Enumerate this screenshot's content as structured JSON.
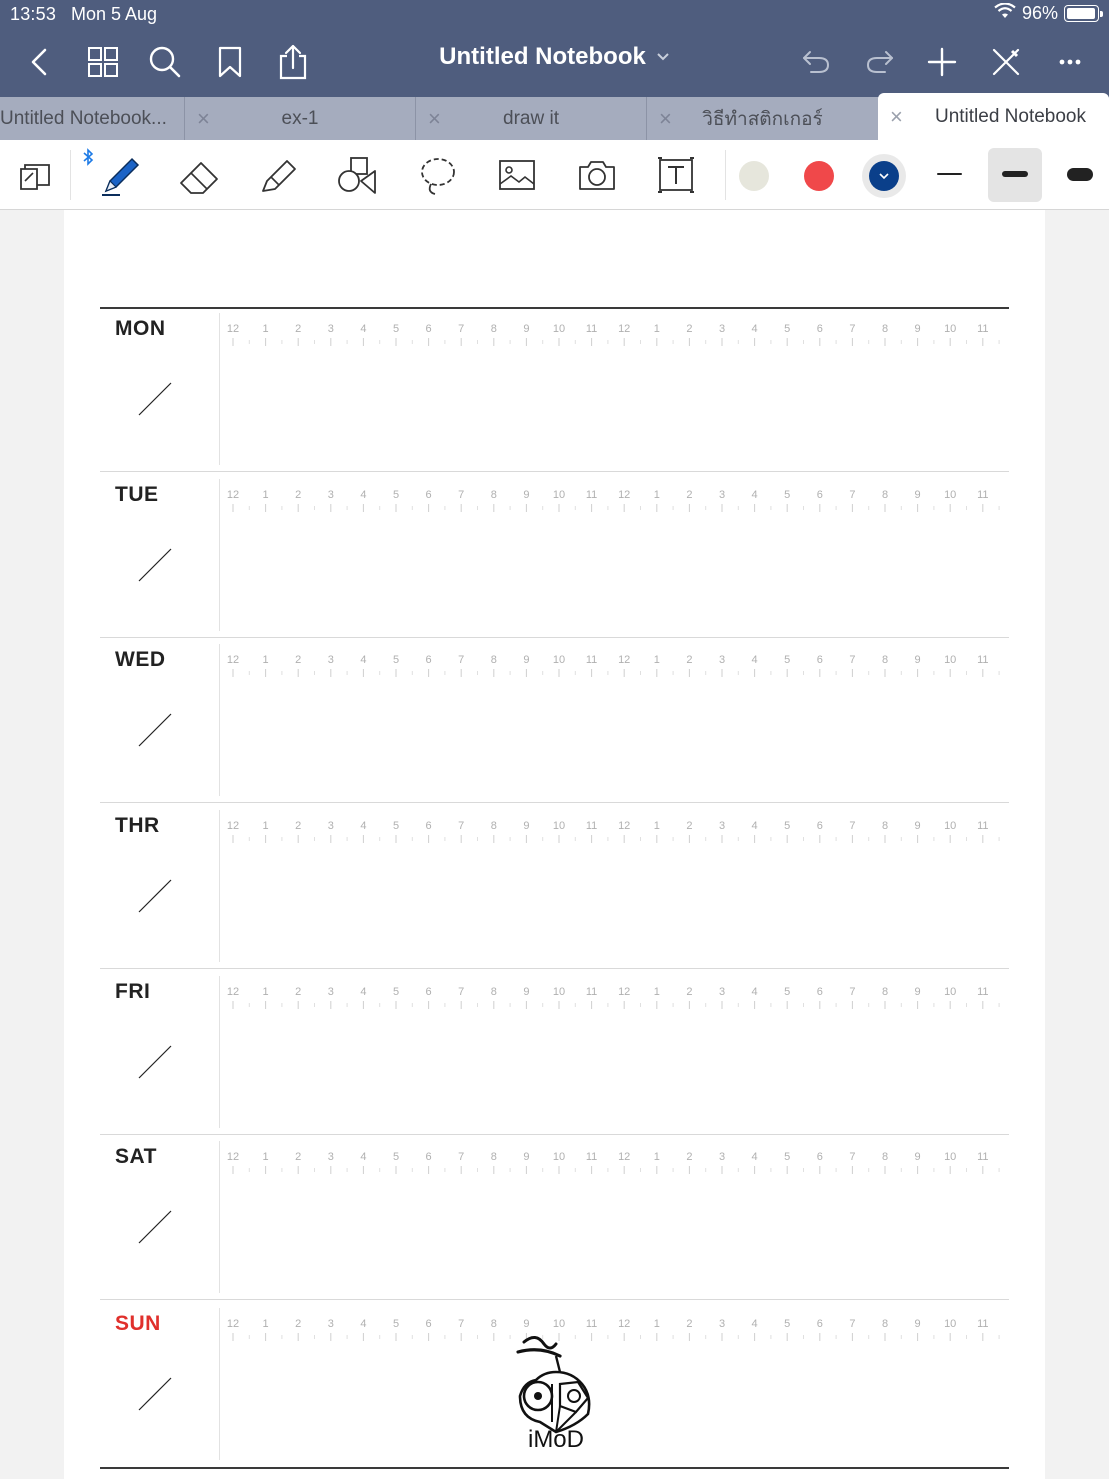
{
  "status": {
    "time": "13:53",
    "date": "Mon 5 Aug",
    "battery": "96%"
  },
  "nav": {
    "title": "Untitled Notebook"
  },
  "tabs": [
    {
      "label": "Untitled Notebook...",
      "active": false
    },
    {
      "label": "ex-1",
      "active": false
    },
    {
      "label": "draw it",
      "active": false
    },
    {
      "label": "วิธีทำสติกเกอร์",
      "active": false
    },
    {
      "label": "Untitled Notebook",
      "active": true
    }
  ],
  "toolbar": {
    "tools": [
      "doc-view-icon",
      "pen-icon",
      "eraser-icon",
      "highlighter-icon",
      "shapes-icon",
      "lasso-icon",
      "image-icon",
      "camera-icon",
      "text-box-icon"
    ],
    "colors": [
      "#e6e6dc",
      "#f0484a",
      "#0a3f8a"
    ],
    "selected_color": "#0a3f8a",
    "thicknesses": [
      "thin",
      "medium",
      "thick"
    ],
    "selected_thickness": "medium"
  },
  "planner": {
    "days": [
      {
        "label": "MON",
        "color": "#222222"
      },
      {
        "label": "TUE",
        "color": "#222222"
      },
      {
        "label": "WED",
        "color": "#222222"
      },
      {
        "label": "THR",
        "color": "#222222"
      },
      {
        "label": "FRI",
        "color": "#222222"
      },
      {
        "label": "SAT",
        "color": "#222222"
      },
      {
        "label": "SUN",
        "color": "#e0302c"
      }
    ],
    "hours": [
      "12",
      "1",
      "2",
      "3",
      "4",
      "5",
      "6",
      "7",
      "8",
      "9",
      "10",
      "11",
      "12",
      "1",
      "2",
      "3",
      "4",
      "5",
      "6",
      "7",
      "8",
      "9",
      "10",
      "11"
    ]
  },
  "watermark": {
    "text": "iMoD"
  }
}
